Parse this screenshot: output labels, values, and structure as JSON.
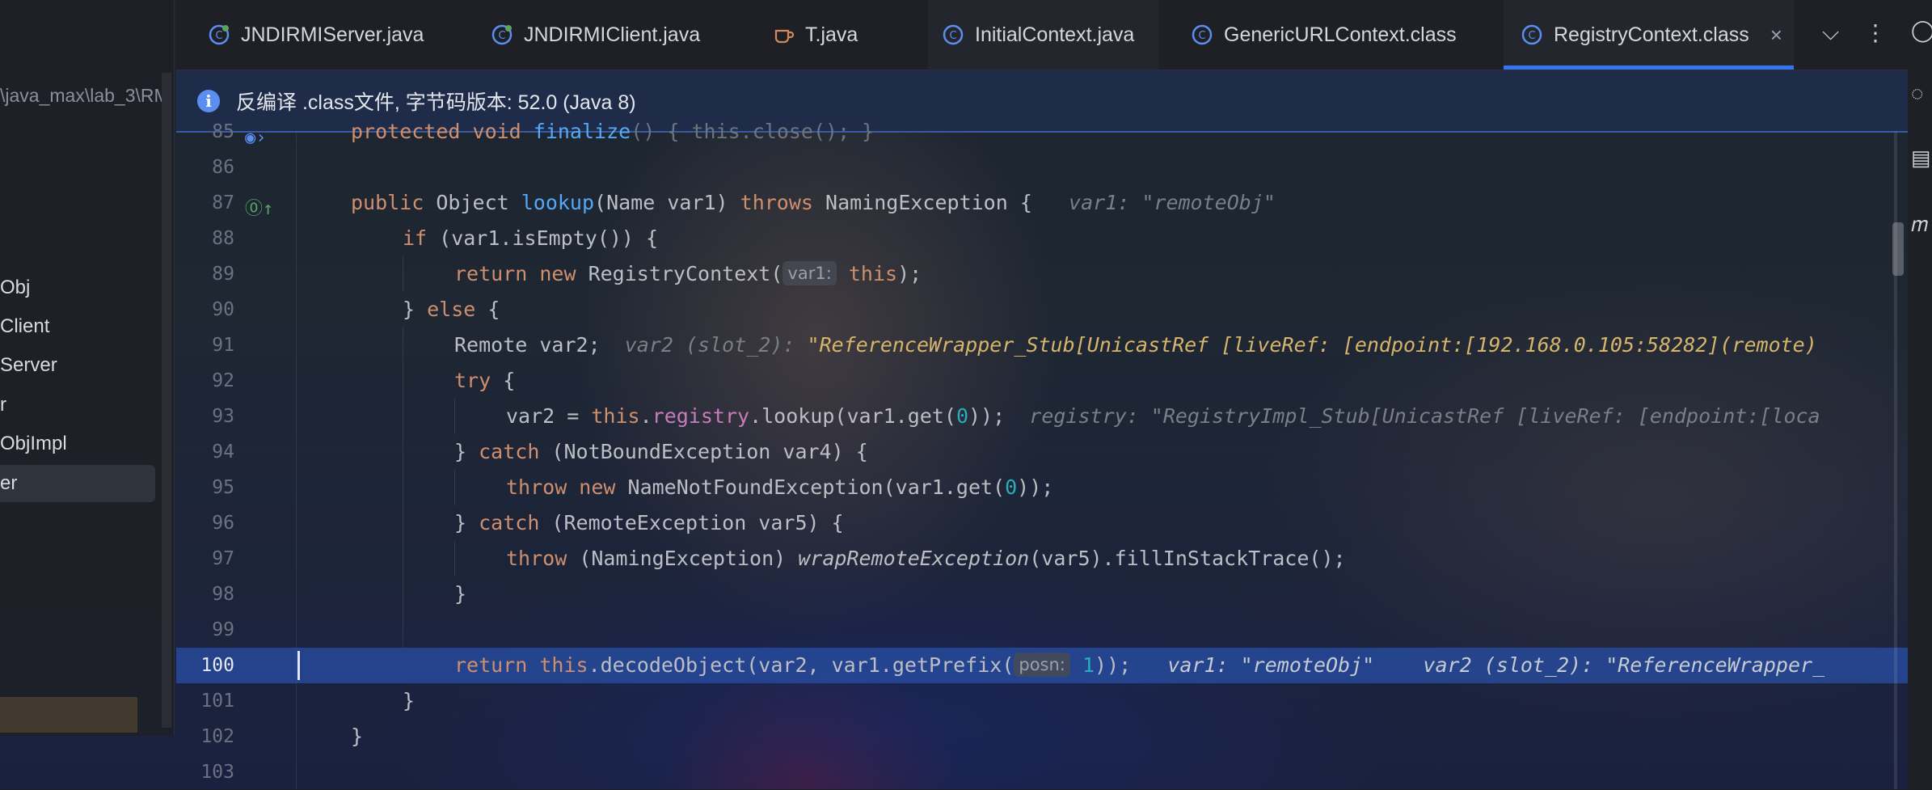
{
  "project": {
    "path_fragment": "\\java_max\\lab_3\\RM",
    "items": [
      "Obj",
      "Client",
      "Server",
      "r",
      "ObjImpl",
      "er"
    ]
  },
  "tabs": [
    {
      "label": "JNDIRMIServer.java",
      "icon": "java-class-icon"
    },
    {
      "label": "JNDIRMIClient.java",
      "icon": "java-class-icon"
    },
    {
      "label": "T.java",
      "icon": "java-file-icon"
    },
    {
      "label": "InitialContext.java",
      "icon": "class-icon"
    },
    {
      "label": "GenericURLContext.class",
      "icon": "class-icon"
    },
    {
      "label": "RegistryContext.class",
      "icon": "class-icon",
      "active": true,
      "close": "×"
    }
  ],
  "tab_buttons": {
    "dropdown": "⌵",
    "more": "⋮"
  },
  "notice": {
    "icon": "i",
    "text": "反编译 .class文件, 字节码版本: 52.0 (Java 8)"
  },
  "editor": {
    "line_numbers": [
      "85",
      "86",
      "87",
      "88",
      "89",
      "90",
      "91",
      "92",
      "93",
      "94",
      "95",
      "96",
      "97",
      "98",
      "99",
      "100",
      "101",
      "102",
      "103"
    ],
    "l85": {
      "a": "protected void ",
      "b": "finalize",
      "c": "() { this.close(); }"
    },
    "l87": {
      "kw1": "public ",
      "t1": "Object ",
      "fn": "lookup",
      "t2": "(Name var1) ",
      "kw2": "throws ",
      "t3": "NamingException {",
      "hint": "var1: \"remoteObj\""
    },
    "l88": {
      "kw": "if ",
      "t": "(var1.isEmpty()) {"
    },
    "l89": {
      "kw1": "return new ",
      "t1": "RegistryContext(",
      "inlay": "var1:",
      "kw2": "this",
      "t2": ");"
    },
    "l90": {
      "t1": "} ",
      "kw": "else ",
      "t2": "{"
    },
    "l91": {
      "t": "Remote var2;",
      "hint": "var2 (slot_2):",
      "val": "\"ReferenceWrapper_Stub[UnicastRef [liveRef: [endpoint:[192.168.0.105:58282](remote)"
    },
    "l92": {
      "kw": "try ",
      "t": "{"
    },
    "l93": {
      "t1": "var2 = ",
      "kw": "this",
      "t2": ".",
      "fld": "registry",
      "t3": ".lookup(var1.get(",
      "num": "0",
      "t4": "));",
      "hint": "registry: \"RegistryImpl_Stub[UnicastRef [liveRef: [endpoint:[loca"
    },
    "l94": {
      "t1": "} ",
      "kw": "catch ",
      "t2": "(NotBoundException var4) {"
    },
    "l95": {
      "kw": "throw new ",
      "t1": "NameNotFoundException(var1.get(",
      "num": "0",
      "t2": "));"
    },
    "l96": {
      "t1": "} ",
      "kw": "catch ",
      "t2": "(RemoteException var5) {"
    },
    "l97": {
      "kw": "throw ",
      "t1": "(NamingException) ",
      "it": "wrapRemoteException",
      "t2": "(var5).fillInStackTrace();"
    },
    "l98": {
      "t": "}"
    },
    "l100": {
      "kw1": "return ",
      "kw2": "this",
      "t1": ".decodeObject(var2, var1.getPrefix(",
      "inlay": "posn:",
      "num": "1",
      "t2": "));",
      "hint1": "var1: \"remoteObj\"",
      "hint2": "var2 (slot_2): \"ReferenceWrapper_"
    },
    "l101": {
      "t": "}"
    },
    "l102": {
      "t": "}"
    }
  }
}
